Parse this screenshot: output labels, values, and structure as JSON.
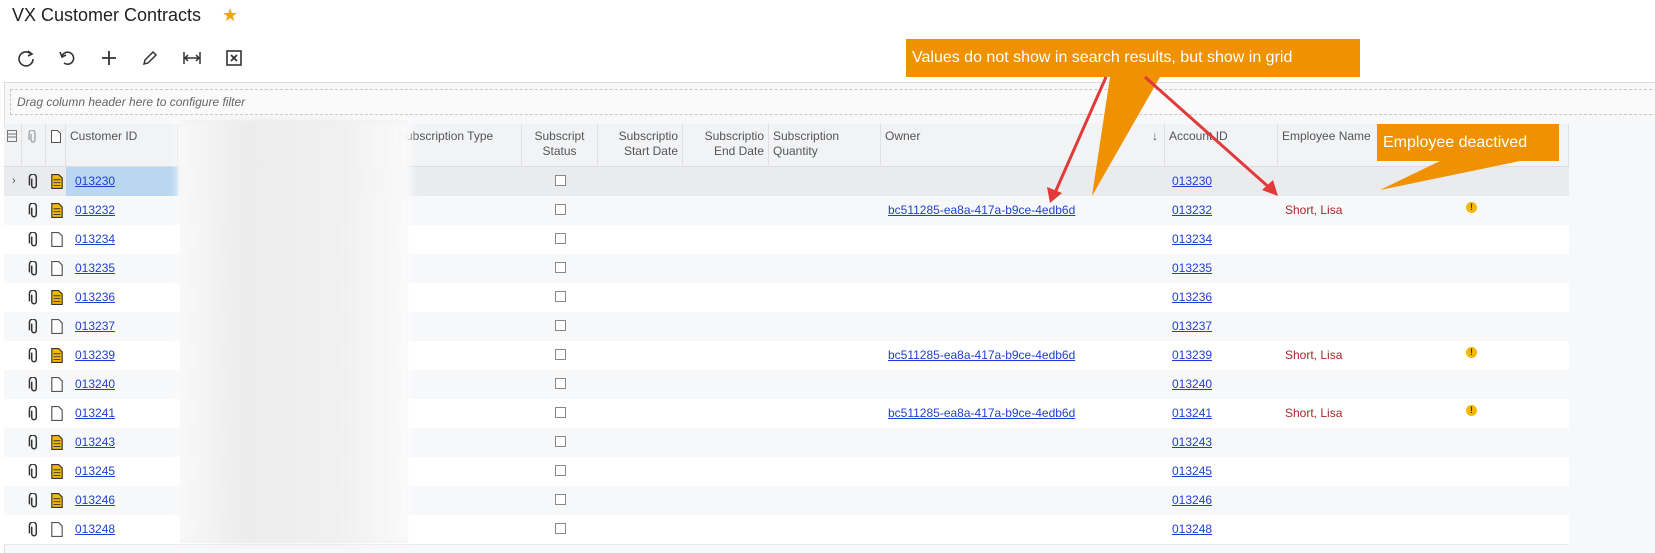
{
  "page": {
    "title": "VX Customer Contracts",
    "favorite_icon": "star-icon"
  },
  "toolbar": {
    "buttons": [
      {
        "name": "refresh-button",
        "icon": "refresh-icon"
      },
      {
        "name": "undo-button",
        "icon": "undo-icon"
      },
      {
        "name": "add-button",
        "icon": "plus-icon"
      },
      {
        "name": "edit-button",
        "icon": "pencil-icon"
      },
      {
        "name": "fit-columns-button",
        "icon": "fit-width-icon"
      },
      {
        "name": "export-excel-button",
        "icon": "excel-icon"
      }
    ]
  },
  "filter": {
    "placeholder": "Drag column header here to configure filter"
  },
  "grid": {
    "columns": {
      "customer_id": "Customer ID",
      "subscription_type": "Subscription Type",
      "subscript_status": "Subscript Status",
      "subscriptio_start": "Subscriptio Start Date",
      "subscriptio_end": "Subscriptio End Date",
      "subscription_quantity": "Subscription Quantity",
      "owner": "Owner",
      "sort_indicator": "↓",
      "account_id": "Account ID",
      "employee_name": "Employee Name"
    },
    "rows": [
      {
        "customer_id": "013230",
        "account_id": "013230",
        "owner": "",
        "employee": "",
        "attach": "filled",
        "note": "yellow",
        "warn": false,
        "selected": true
      },
      {
        "customer_id": "013232",
        "account_id": "013232",
        "owner": "bc511285-ea8a-417a-b9ce-4edb6d",
        "employee": "Short, Lisa",
        "attach": "filled",
        "note": "yellow",
        "warn": true,
        "selected": false
      },
      {
        "customer_id": "013234",
        "account_id": "013234",
        "owner": "",
        "employee": "",
        "attach": "filled",
        "note": "blank",
        "warn": false,
        "selected": false
      },
      {
        "customer_id": "013235",
        "account_id": "013235",
        "owner": "",
        "employee": "",
        "attach": "filled",
        "note": "blank",
        "warn": false,
        "selected": false
      },
      {
        "customer_id": "013236",
        "account_id": "013236",
        "owner": "",
        "employee": "",
        "attach": "filled",
        "note": "yellow",
        "warn": false,
        "selected": false
      },
      {
        "customer_id": "013237",
        "account_id": "013237",
        "owner": "",
        "employee": "",
        "attach": "filled",
        "note": "blank",
        "warn": false,
        "selected": false
      },
      {
        "customer_id": "013239",
        "account_id": "013239",
        "owner": "bc511285-ea8a-417a-b9ce-4edb6d",
        "employee": "Short, Lisa",
        "attach": "filled",
        "note": "yellow",
        "warn": true,
        "selected": false
      },
      {
        "customer_id": "013240",
        "account_id": "013240",
        "owner": "",
        "employee": "",
        "attach": "filled",
        "note": "blank",
        "warn": false,
        "selected": false
      },
      {
        "customer_id": "013241",
        "account_id": "013241",
        "owner": "bc511285-ea8a-417a-b9ce-4edb6d",
        "employee": "Short, Lisa",
        "attach": "filled",
        "note": "blank",
        "warn": true,
        "selected": false
      },
      {
        "customer_id": "013243",
        "account_id": "013243",
        "owner": "",
        "employee": "",
        "attach": "filled",
        "note": "yellow",
        "warn": false,
        "selected": false
      },
      {
        "customer_id": "013245",
        "account_id": "013245",
        "owner": "",
        "employee": "",
        "attach": "filled",
        "note": "yellow",
        "warn": false,
        "selected": false
      },
      {
        "customer_id": "013246",
        "account_id": "013246",
        "owner": "",
        "employee": "",
        "attach": "filled",
        "note": "yellow",
        "warn": false,
        "selected": false
      },
      {
        "customer_id": "013248",
        "account_id": "013248",
        "owner": "",
        "employee": "",
        "attach": "filled",
        "note": "blank",
        "warn": false,
        "selected": false
      }
    ]
  },
  "annotations": {
    "callout_values": "Values do not show in search results, but show in grid",
    "callout_employee": "Employee deactived",
    "callout_color": "#ef9100",
    "arrow_color": "#e03a3a"
  }
}
